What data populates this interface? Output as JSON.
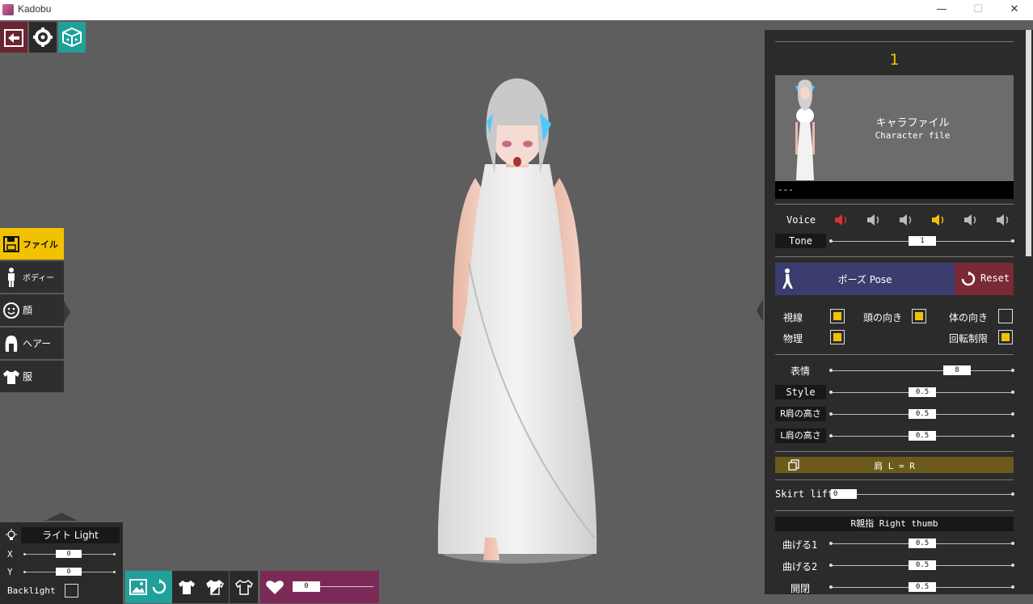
{
  "window": {
    "title": "Kadobu",
    "minimize": "—",
    "maximize": "☐",
    "close": "✕"
  },
  "left_menu": [
    {
      "label": "ファイル",
      "icon": "floppy-disk-icon",
      "active": true
    },
    {
      "label": "ボディー",
      "icon": "body-figure-icon",
      "active": false
    },
    {
      "label": "顔",
      "icon": "face-icon",
      "active": false
    },
    {
      "label": "ヘアー",
      "icon": "hair-icon",
      "active": false
    },
    {
      "label": "服",
      "icon": "shirt-icon",
      "active": false
    }
  ],
  "light": {
    "title": "ライト Light",
    "x_label": "X",
    "x_value": "0",
    "y_label": "Y",
    "y_value": "0",
    "backlight_label": "Backlight"
  },
  "bottom_bar": {
    "heart_value": "0"
  },
  "right_panel": {
    "slot_number": "1",
    "card_title_jp": "キャラファイル",
    "card_title_en": "Character file",
    "card_footer": "---",
    "voice_label": "Voice",
    "tone_label": "Tone",
    "tone_value": "1",
    "pose_button": "ポーズ Pose",
    "reset_button": "Reset",
    "checks": {
      "gaze": "視線",
      "head_dir": "頭の向き",
      "body_dir": "体の向き",
      "physics": "物理",
      "rotation_limit": "回転制限"
    },
    "expression_label": "表情",
    "expression_value": "8",
    "style_label": "Style",
    "style_value": "0.5",
    "r_shoulder_label": "R肩の高さ",
    "r_shoulder_value": "0.5",
    "l_shoulder_label": "L肩の高さ",
    "l_shoulder_value": "0.5",
    "copy_shoulder_label": "肩 L = R",
    "skirt_label": "Skirt lift",
    "skirt_value": "0",
    "thumb_header": "R親指 Right thumb",
    "bend1_label": "曲げる1",
    "bend1_value": "0.5",
    "bend2_label": "曲げる2",
    "bend2_value": "0.5",
    "open_label": "開閉",
    "open_value": "0.5"
  },
  "colors": {
    "accent": "#f2c200",
    "pose_bar": "#3b3d6e",
    "reset_bar": "#7a2a35",
    "heart_bar": "#7b2a58",
    "teal": "#1fa09a"
  }
}
